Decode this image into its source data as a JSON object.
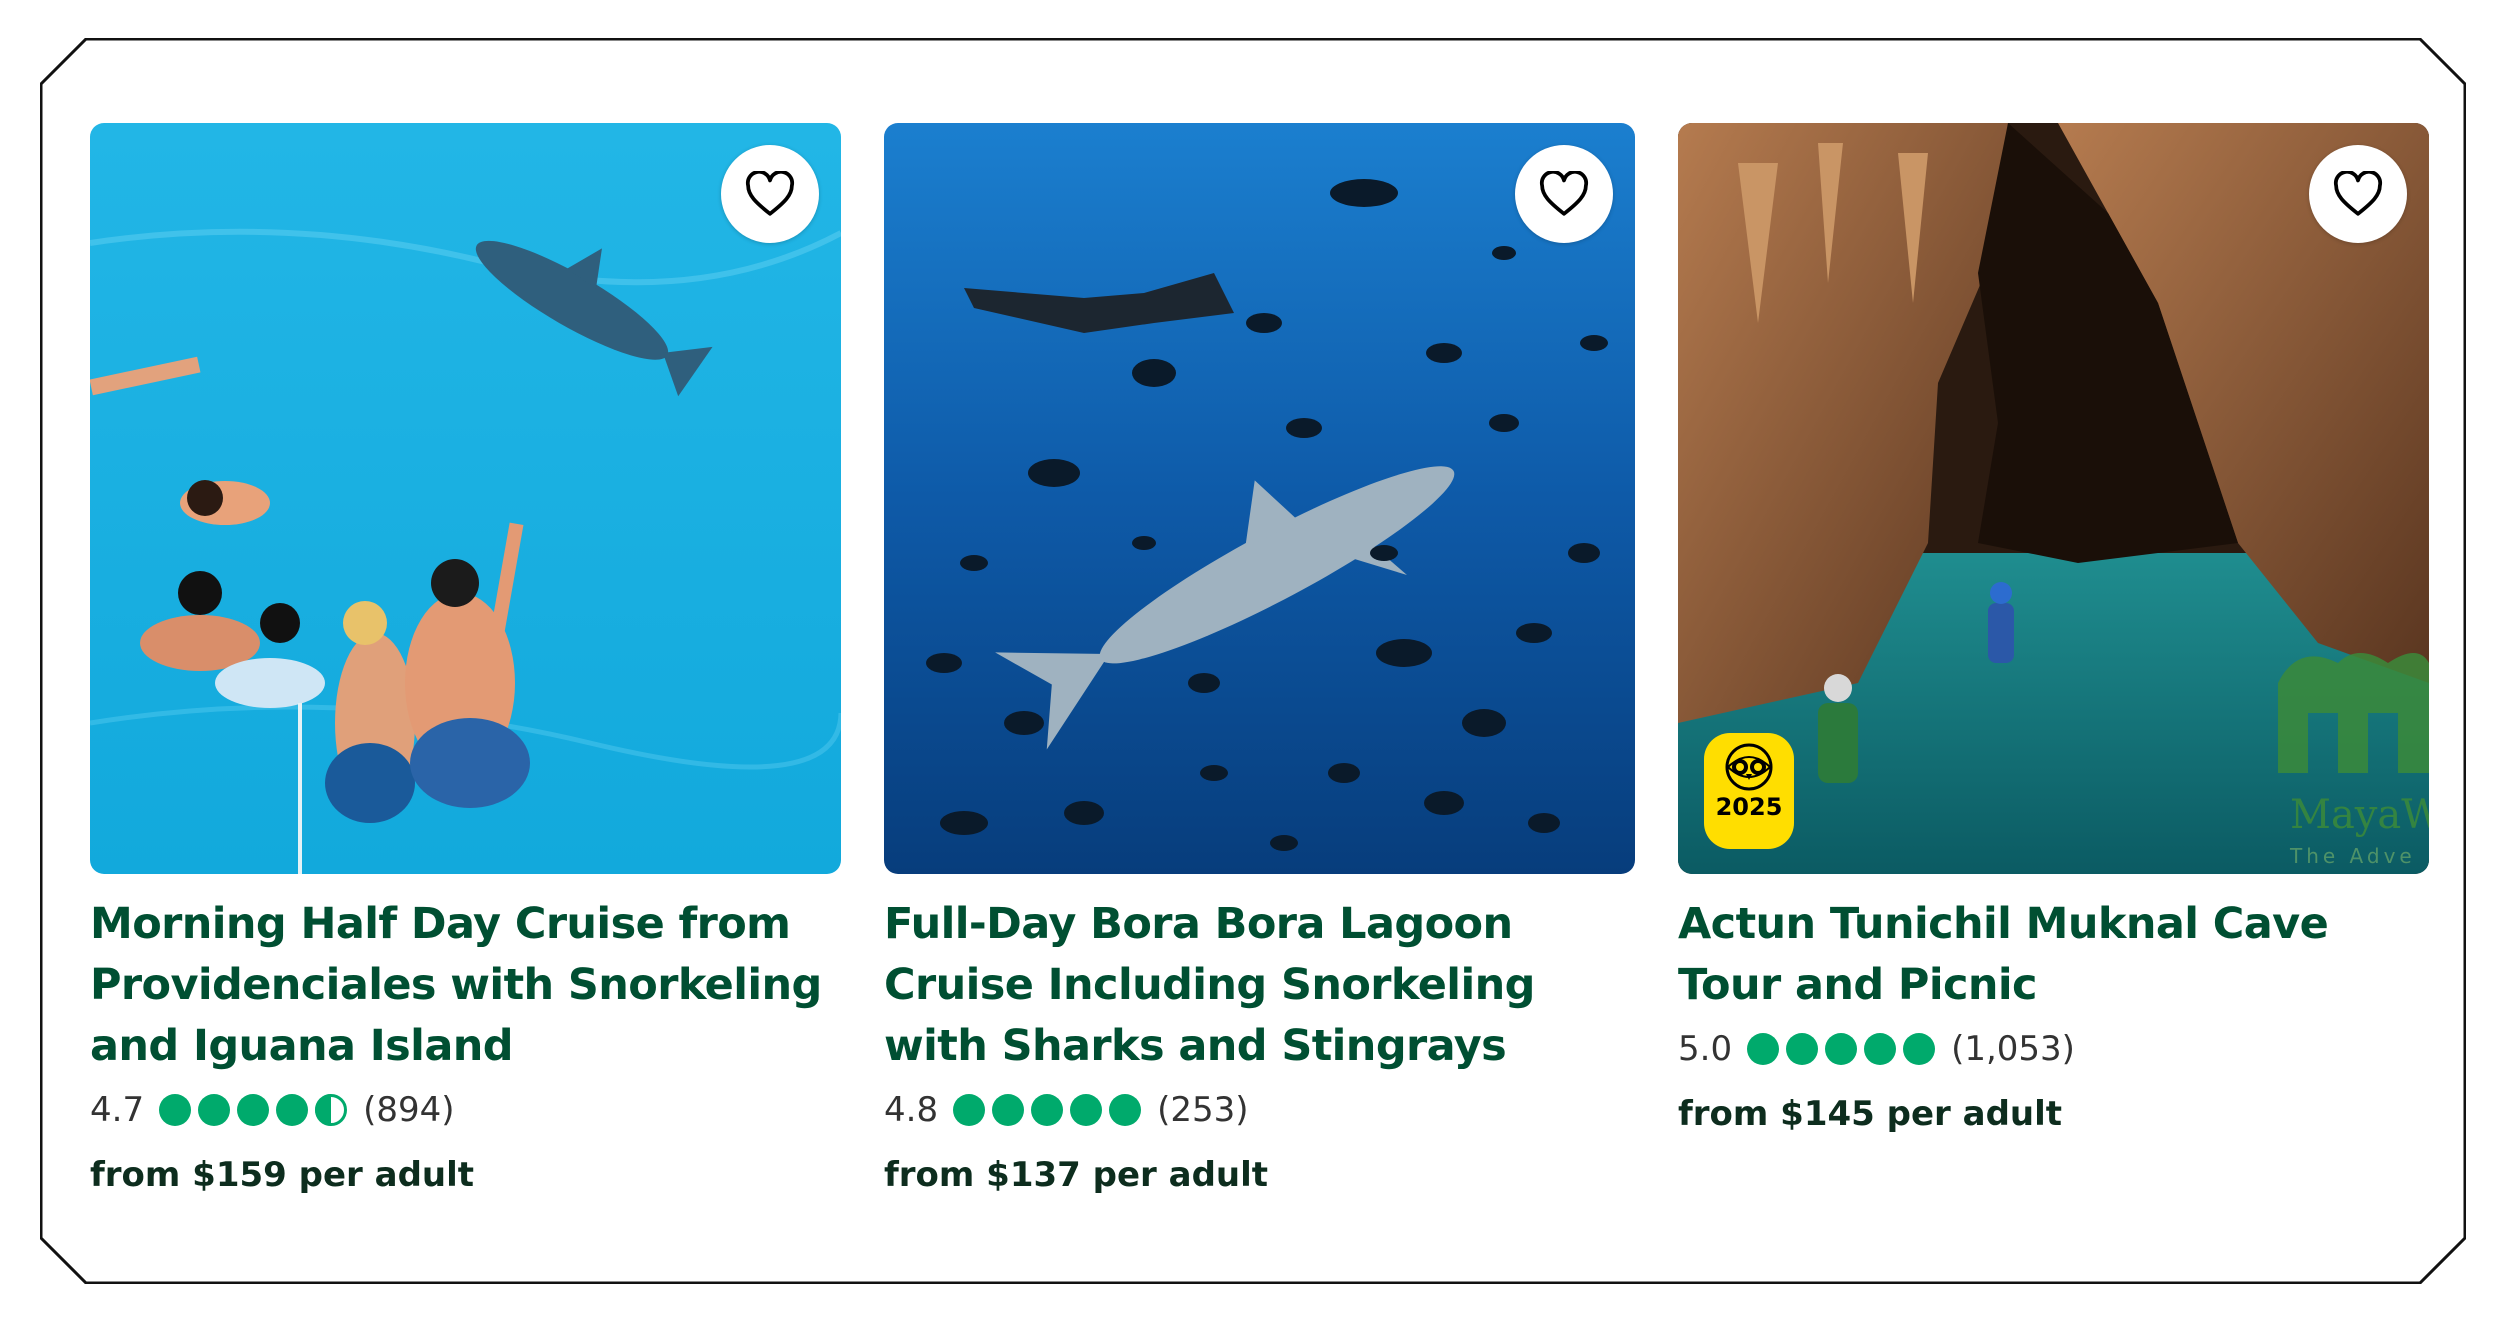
{
  "colors": {
    "title": "#004f32",
    "bubble": "#00aa6c",
    "award": "#ffde00",
    "text": "#333333"
  },
  "cards": [
    {
      "title": "Morning Half Day Cruise from Providenciales with Snorkeling and Iguana Island",
      "rating": "4.7",
      "bubbles": 4.5,
      "reviews": "(894)",
      "price": "from $159 per adult",
      "image": "snorkelers-with-dolphin"
    },
    {
      "title": "Full-Day Bora Bora Lagoon Cruise Including Snorkeling with Sharks and Stingrays",
      "rating": "4.8",
      "bubbles": 5,
      "reviews": "(253)",
      "price": "from $137 per adult",
      "image": "shark-and-fish-underwater"
    },
    {
      "title": "Actun Tunichil Muknal Cave Tour and Picnic",
      "rating": "5.0",
      "bubbles": 5,
      "reviews": "(1,053)",
      "price": "from $145 per adult",
      "image": "cave-with-turquoise-water",
      "award_year": "2025",
      "watermark": "MayaWa",
      "watermark_sub": "The Adve"
    }
  ]
}
